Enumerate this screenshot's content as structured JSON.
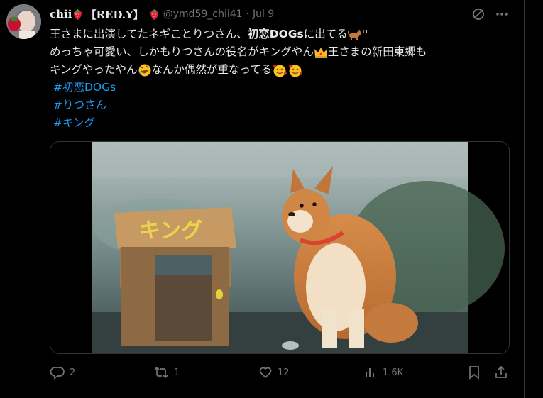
{
  "tweet": {
    "display_name": "chii",
    "name_suffix": "【RED.Y】",
    "handle": "@ymd59_chii41",
    "separator": "·",
    "date": "Jul 9",
    "line1_a": "王さまに出演してたネギことりつさん、",
    "line1_b": "初恋DOGs",
    "line1_c": "に出てる",
    "line1_d": "''",
    "line2_a": "めっちゃ可愛い、しかもりつさんの役名がキングやん",
    "line2_b": "王さまの新田東郷も",
    "line3_a": "キングやったやん",
    "line3_b": "なんか偶然が重なってる",
    "hashtags": [
      "#初恋DOGs",
      "#りつさん",
      "#キング"
    ],
    "sign_text": "キング"
  },
  "actions": {
    "replies": "2",
    "reposts": "1",
    "likes": "12",
    "views": "1.6K"
  },
  "icons": [
    "strawberry-icon",
    "grok-icon",
    "more-icon",
    "dog-emoji",
    "crown-emoji",
    "rofl-emoji",
    "smiling-hearts-emoji",
    "reply-icon",
    "repost-icon",
    "like-icon",
    "views-icon",
    "bookmark-icon",
    "share-icon"
  ],
  "colors": {
    "accent": "#1d9bf0",
    "muted": "#71767b",
    "text": "#e7e9ea",
    "border": "#2f3336"
  }
}
